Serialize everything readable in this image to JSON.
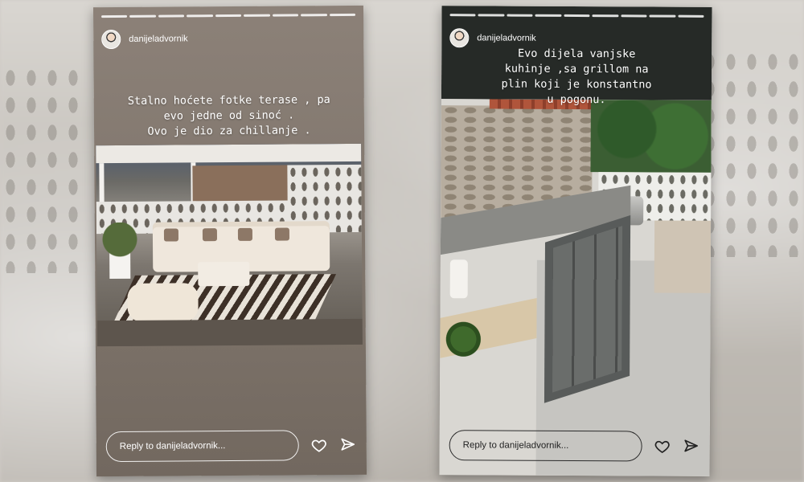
{
  "stories": [
    {
      "username": "danijeladvornik",
      "caption_lines": [
        "Stalno hoćete fotke terase , pa",
        "evo jedne od sinoć .",
        "Ovo je dio za chillanje ."
      ],
      "reply_placeholder": "Reply to danijeladvornik...",
      "icons": [
        "heart-icon",
        "send-icon"
      ]
    },
    {
      "username": "danijeladvornik",
      "caption_lines": [
        "Evo dijela vanjske",
        "kuhinje ,sa grillom na",
        "plin koji je konstantno",
        "u pogonu."
      ],
      "reply_placeholder": "Reply to danijeladvornik...",
      "icons": [
        "heart-icon",
        "send-icon"
      ]
    }
  ]
}
